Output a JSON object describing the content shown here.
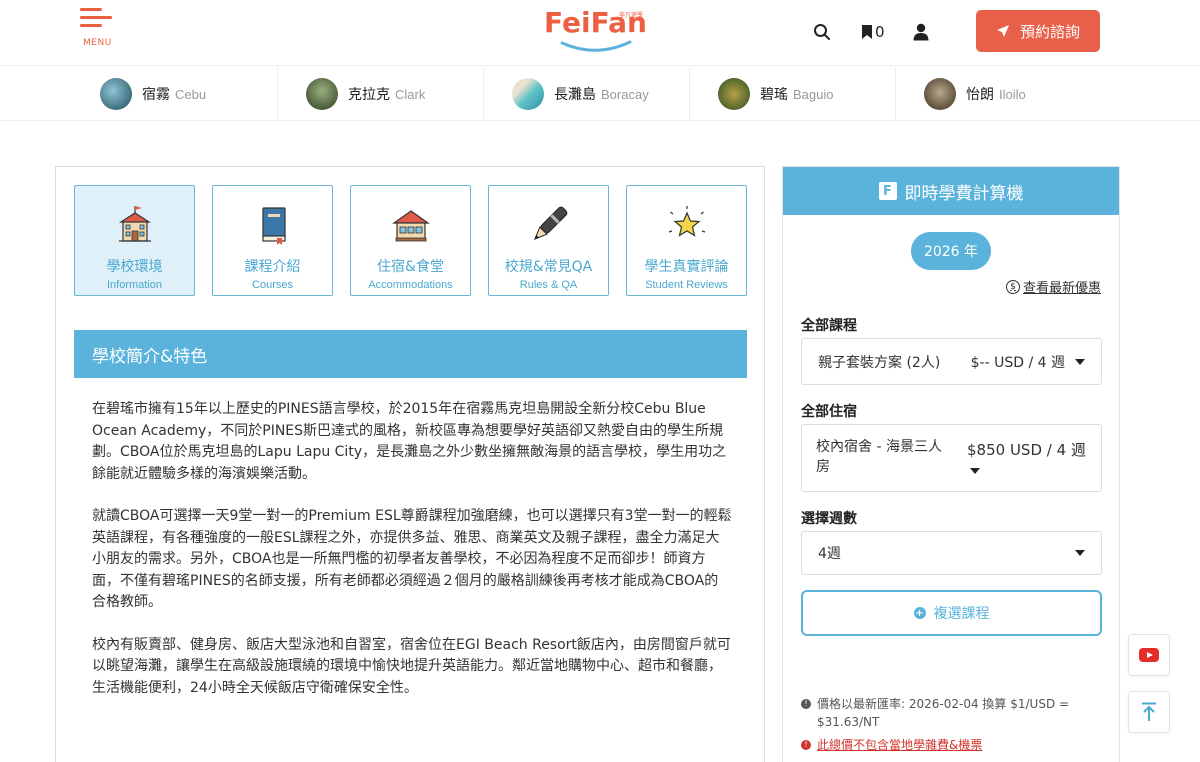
{
  "header": {
    "menu_label": "MENU",
    "logo_text": "FeiFan",
    "logo_small": "非凡遊學",
    "bookmark_count": "0",
    "consult_label": "預約諮詢"
  },
  "destinations": [
    {
      "zh": "宿霧",
      "en": "Cebu"
    },
    {
      "zh": "克拉克",
      "en": "Clark"
    },
    {
      "zh": "長灘島",
      "en": "Boracay"
    },
    {
      "zh": "碧瑤",
      "en": "Baguio"
    },
    {
      "zh": "怡朗",
      "en": "Iloilo"
    }
  ],
  "tabs": [
    {
      "zh": "學校環境",
      "en": "Information"
    },
    {
      "zh": "課程介紹",
      "en": "Courses"
    },
    {
      "zh": "住宿&食堂",
      "en": "Accommodations"
    },
    {
      "zh": "校規&常見QA",
      "en": "Rules & QA"
    },
    {
      "zh": "學生真實評論",
      "en": "Student Reviews"
    }
  ],
  "section": {
    "title": "學校簡介&特色",
    "paragraphs": [
      "在碧瑤市擁有15年以上歷史的PINES語言學校，於2015年在宿霧馬克坦島開設全新分校Cebu Blue Ocean Academy，不同於PINES斯巴達式的風格，新校區專為想要學好英語卻又熱愛自由的學生所規劃。CBOA位於馬克坦島的Lapu Lapu City，是長灘島之外少數坐擁無敵海景的語言學校，學生用功之餘能就近體驗多樣的海濱娛樂活動。",
      "就讀CBOA可選擇一天9堂一對一的Premium ESL尊爵課程加強磨練，也可以選擇只有3堂一對一的輕鬆英語課程，有各種強度的一般ESL課程之外，亦提供多益、雅思、商業英文及親子課程，盡全力滿足大小朋友的需求。另外，CBOA也是一所無門檻的初學者友善學校，不必因為程度不足而卻步！師資方面，不僅有碧瑤PINES的名師支援，所有老師都必須經過２個月的嚴格訓練後再考核才能成為CBOA的合格教師。",
      "校內有販賣部、健身房、飯店大型泳池和自習室，宿舍位在EGI Beach Resort飯店內，由房間窗戶就可以眺望海灘，讓學生在高級設施環繞的環境中愉快地提升英語能力。鄰近當地購物中心、超市和餐廳，生活機能便利，24小時全天候飯店守衛確保安全性。"
    ]
  },
  "calculator": {
    "title": "即時學費計算機",
    "badge": "F",
    "year": "2026 年",
    "promo_label": "查看最新優惠",
    "course_label": "全部課程",
    "course_value": "親子套裝方案 (2人)",
    "course_price": "$-- USD / 4 週",
    "room_label": "全部住宿",
    "room_value": "校內宿舍 - 海景三人房",
    "room_price": "$850 USD / 4 週",
    "weeks_label": "選擇週數",
    "weeks_value": "4週",
    "multi_label": "複選課程",
    "note_rate": "價格以最新匯率: 2026-02-04 換算 $1/USD = $31.63/NT",
    "note_excl": "此總價不包含當地學雜費&機票"
  },
  "colors": {
    "brand_orange": "#e8604a",
    "brand_blue": "#5bb3dc"
  }
}
